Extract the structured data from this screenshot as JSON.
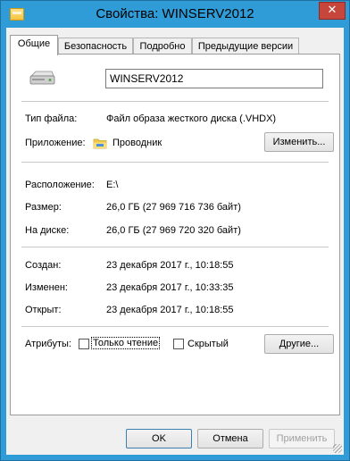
{
  "window": {
    "title": "Свойства: WINSERV2012",
    "close_glyph": "✕"
  },
  "tabs": [
    {
      "label": "Общие"
    },
    {
      "label": "Безопасность"
    },
    {
      "label": "Подробно"
    },
    {
      "label": "Предыдущие версии"
    }
  ],
  "general": {
    "name_value": "WINSERV2012",
    "file_type_label": "Тип файла:",
    "file_type_value": "Файл образа жесткого диска (.VHDX)",
    "app_label": "Приложение:",
    "app_value": "Проводник",
    "change_button": "Изменить...",
    "location_label": "Расположение:",
    "location_value": "E:\\",
    "size_label": "Размер:",
    "size_value": "26,0 ГБ (27 969 716 736 байт)",
    "disk_size_label": "На диске:",
    "disk_size_value": "26,0 ГБ (27 969 720 320 байт)",
    "created_label": "Создан:",
    "created_value": "23 декабря 2017 г., 10:18:55",
    "modified_label": "Изменен:",
    "modified_value": "23 декабря 2017 г., 10:33:35",
    "opened_label": "Открыт:",
    "opened_value": "23 декабря 2017 г., 10:18:55",
    "attributes_label": "Атрибуты:",
    "readonly_label": "Только чтение",
    "readonly_checked": false,
    "hidden_label": "Скрытый",
    "hidden_checked": false,
    "other_button": "Другие..."
  },
  "footer": {
    "ok": "OK",
    "cancel": "Отмена",
    "apply": "Применить"
  },
  "colors": {
    "title_bar": "#2f9cd8",
    "close_button": "#c7463b"
  },
  "icons": {
    "file": "hard-disk-icon",
    "app": "explorer-folder-icon",
    "window": "folder-icon"
  }
}
